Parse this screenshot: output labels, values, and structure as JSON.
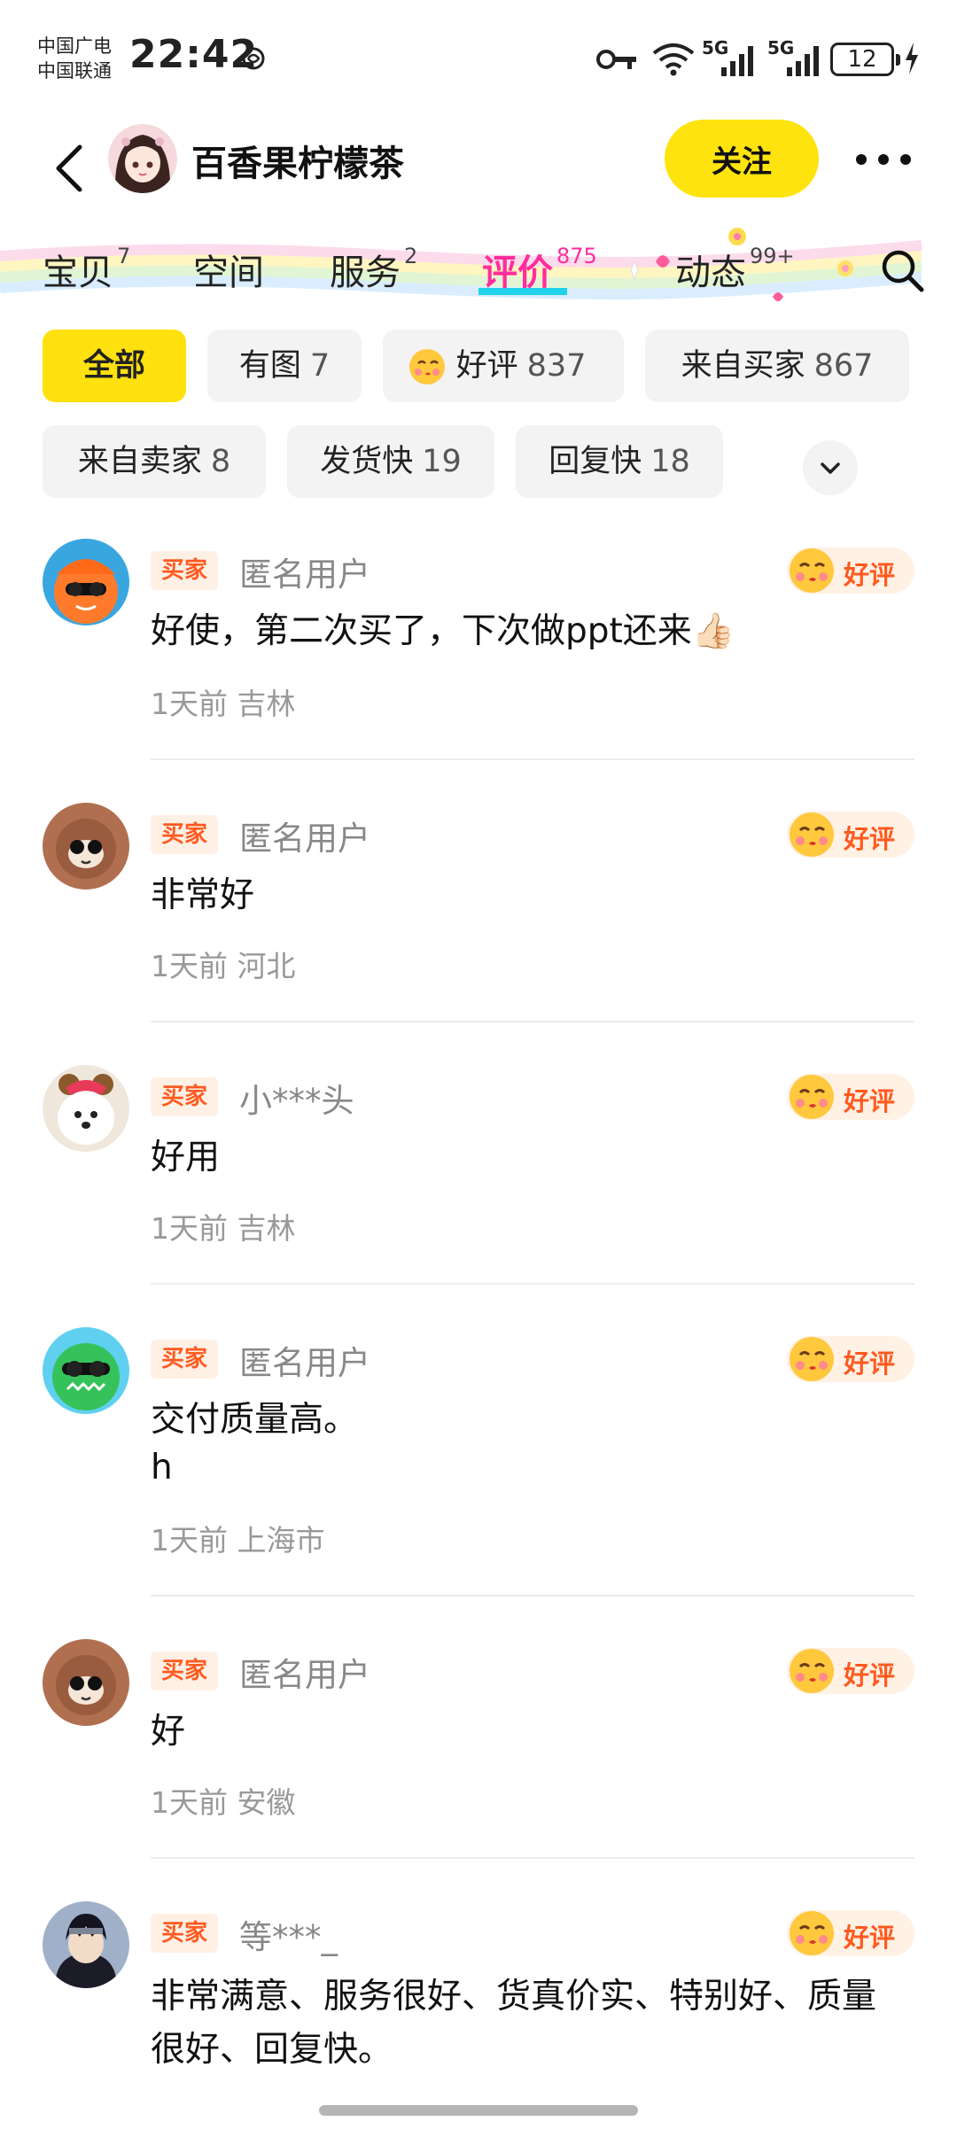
{
  "status_bar": {
    "carrier_1": "中国广电",
    "carrier_2": "中国联通",
    "time": "22:42",
    "network_1": "5G",
    "network_2": "5G",
    "battery": "12"
  },
  "header": {
    "shop_name": "百香果柠檬茶",
    "follow_label": "关注"
  },
  "tabs": [
    {
      "label": "宝贝",
      "count": "7"
    },
    {
      "label": "空间",
      "count": ""
    },
    {
      "label": "服务",
      "count": "2"
    },
    {
      "label": "评价",
      "count": "875",
      "active": true
    },
    {
      "label": "动态",
      "count": "99+"
    }
  ],
  "filters": [
    {
      "label": "全部",
      "count": ""
    },
    {
      "label": "有图",
      "count": "7"
    },
    {
      "label": "好评",
      "count": "837"
    },
    {
      "label": "来自买家",
      "count": "867"
    },
    {
      "label": "来自卖家",
      "count": "8"
    },
    {
      "label": "发货快",
      "count": "19"
    },
    {
      "label": "回复快",
      "count": "18"
    }
  ],
  "reviews": [
    {
      "tag": "买家",
      "user": "匿名用户",
      "badge": "好评",
      "text": "好使，第二次买了，下次做ppt还来👍🏻",
      "time": "1天前",
      "location": "吉林"
    },
    {
      "tag": "买家",
      "user": "匿名用户",
      "badge": "好评",
      "text": "非常好",
      "time": "1天前",
      "location": "河北"
    },
    {
      "tag": "买家",
      "user": "小***头",
      "badge": "好评",
      "text": "好用",
      "time": "1天前",
      "location": "吉林"
    },
    {
      "tag": "买家",
      "user": "匿名用户",
      "badge": "好评",
      "text_line1": "交付质量高。",
      "text_line2": "h",
      "time": "1天前",
      "location": "上海市"
    },
    {
      "tag": "买家",
      "user": "匿名用户",
      "badge": "好评",
      "text": "好",
      "time": "1天前",
      "location": "安徽"
    },
    {
      "tag": "买家",
      "user": "等***_",
      "badge": "好评",
      "text": "非常满意、服务很好、货真价实、特别好、质量很好、回复快。"
    }
  ],
  "colors": {
    "accent_yellow": "#ffe30f",
    "active_tab_pink": "#ff2d9d",
    "badge_orange": "#ff5a1f"
  }
}
